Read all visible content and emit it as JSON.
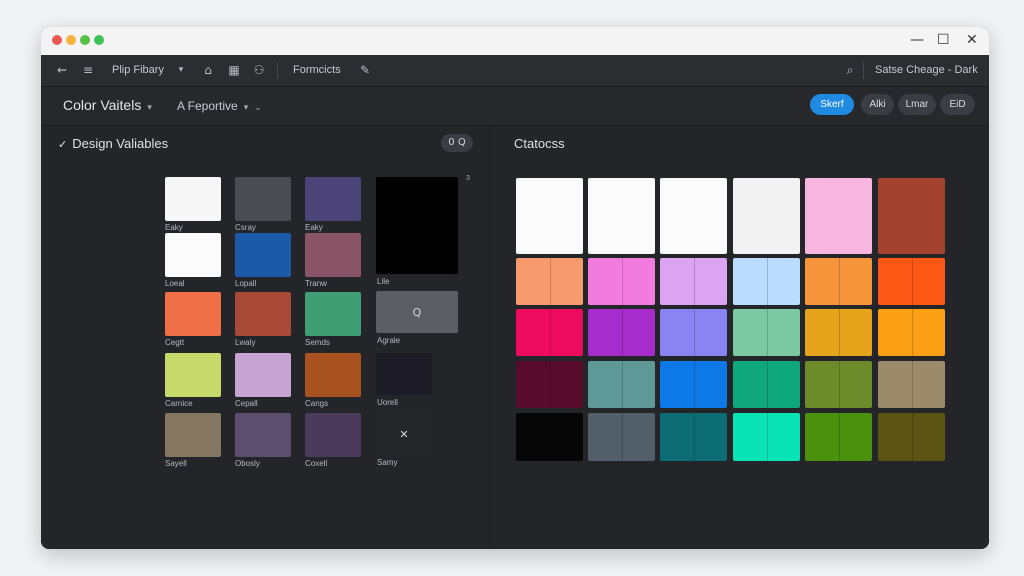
{
  "window": {
    "controls": {
      "minimize": "—",
      "maximize": "☐",
      "close": "✕"
    }
  },
  "toolbar": {
    "library_label": "Plip Fibary",
    "formats_label": "Formcicts",
    "right_label": "Satse Cheage - Dark"
  },
  "header": {
    "title": "Color Vaitels",
    "subtitle": "A Feportive",
    "buttons": [
      "Skerf",
      "Alki",
      "Lmar",
      "EiD"
    ]
  },
  "left_panel": {
    "title": "Design Valiables",
    "search_icon": "0 Q",
    "corner_mark": "3",
    "swatches": [
      {
        "label": "Eaky",
        "color": "#f7f7f7"
      },
      {
        "label": "Csray",
        "color": "#4a4c51"
      },
      {
        "label": "Eaky",
        "color": "#4c4479"
      },
      {
        "label": "Loeal",
        "color": "#fbfbfb"
      },
      {
        "label": "Lopall",
        "color": "#1a5aa8"
      },
      {
        "label": "Tranw",
        "color": "#8a5467"
      },
      {
        "label": "Cegtt",
        "color": "#ef6f46"
      },
      {
        "label": "Lwaly",
        "color": "#a84837"
      },
      {
        "label": "Semds",
        "color": "#3f9e74"
      },
      {
        "label": "Carnice",
        "color": "#c7d96b"
      },
      {
        "label": "Cepall",
        "color": "#c7a3d4"
      },
      {
        "label": "Cangs",
        "color": "#a7521f"
      },
      {
        "label": "Sayell",
        "color": "#857662"
      },
      {
        "label": "Obosly",
        "color": "#5c4e6e"
      },
      {
        "label": "Coxell",
        "color": "#4a3a5c"
      }
    ],
    "big_swatches": [
      {
        "label": "Lile",
        "color": "#000000"
      },
      {
        "label": "Agrale",
        "color": "#5c5e63",
        "icon": "Q"
      },
      {
        "label": "Uorell",
        "color": "#1d1c26"
      },
      {
        "label": "Samy",
        "color": "#25262a",
        "icon": "✕"
      }
    ]
  },
  "right_panel": {
    "title": "Ctatocss",
    "grid": [
      [
        "#fbfbfb",
        "#fbfbfb",
        "#fbfbfb",
        "#f2f2f2",
        "#f7b6e0",
        "#a3422e"
      ],
      [
        "#f79a6e",
        "#f27be0",
        "#dba4f2",
        "#b9dcff",
        "#f7953d",
        "#fd5715"
      ],
      [
        "#ec0b5c",
        "#a72ccc",
        "#8a83f2",
        "#7bc9a3",
        "#e6a31c",
        "#fb9f14"
      ],
      [
        "#580b2b",
        "#5e9998",
        "#0d79e6",
        "#0fa87c",
        "#6e8b2b",
        "#9b8b6b"
      ],
      [
        "#060606",
        "#525e68",
        "#0c6e74",
        "#0ae3b6",
        "#4b910d",
        "#5b5412"
      ]
    ]
  }
}
